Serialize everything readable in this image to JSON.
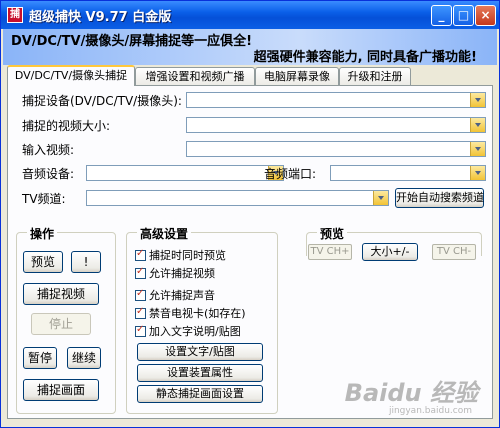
{
  "window": {
    "title": "超级捕快 V9.77 白金版",
    "icon_label": "捕",
    "minimize_label": "_",
    "maximize_label": "□",
    "close_label": "×"
  },
  "banner": {
    "line1": "DV/DC/TV/摄像头/屏幕捕捉等一应俱全!",
    "line2": "超强硬件兼容能力, 同时具备广播功能!"
  },
  "tabs": [
    {
      "label": "DV/DC/TV/摄像头捕捉",
      "active": true
    },
    {
      "label": "增强设置和视频广播",
      "active": false
    },
    {
      "label": "电脑屏幕录像",
      "active": false
    },
    {
      "label": "升级和注册",
      "active": false
    }
  ],
  "form": {
    "capture_device_label": "捕捉设备(DV/DC/TV/摄像头):",
    "video_size_label": "捕捉的视频大小:",
    "video_input_label": "输入视频:",
    "audio_device_label": "音频设备:",
    "audio_port_label": "音频端口:",
    "tv_channel_label": "TV频道:",
    "auto_search_label": "开始自动搜索频道"
  },
  "ops": {
    "title": "操作",
    "preview": "预览",
    "bang": "!",
    "capture_video": "捕捉视频",
    "stop": "停止",
    "pause": "暂停",
    "resume": "继续",
    "capture_frame": "捕捉画面"
  },
  "advanced": {
    "title": "高级设置",
    "options": [
      {
        "label": "捕捉时同时预览",
        "checked": true
      },
      {
        "label": "允许捕捉视频",
        "checked": true
      },
      {
        "label": "允许捕捉声音",
        "checked": true
      },
      {
        "label": "禁音电视卡(如存在)",
        "checked": true
      },
      {
        "label": "加入文字说明/贴图",
        "checked": true
      }
    ],
    "set_text_button": "设置文字/贴图",
    "device_props_button": "设置装置属性",
    "still_capture_button": "静态捕捉画面设置"
  },
  "preview": {
    "title": "预览",
    "tv_ch_plus": "TV CH+",
    "size_toggle": "大小+/-",
    "tv_ch_minus": "TV CH-"
  },
  "watermark": {
    "brand": "Baidu 经验",
    "url": "jingyan.baidu.com"
  }
}
